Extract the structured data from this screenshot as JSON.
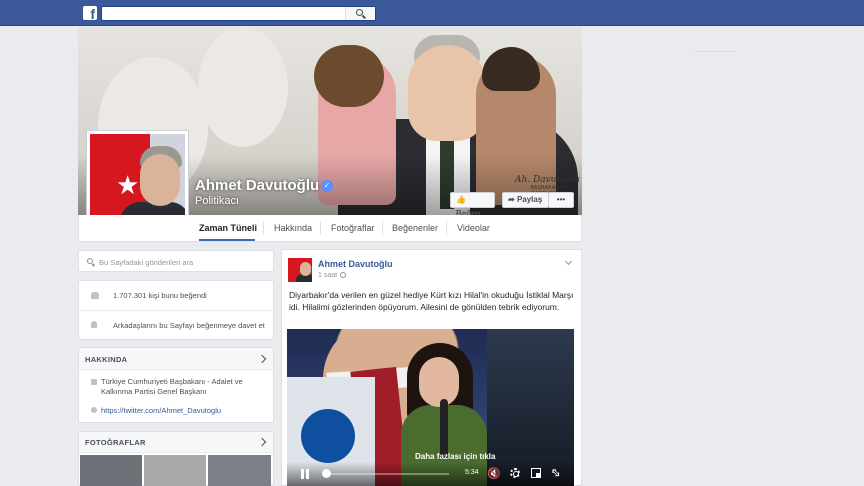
{
  "topbar": {
    "logo": "f",
    "search_placeholder": ""
  },
  "profile": {
    "name": "Ahmet Davutoğlu",
    "verified": "✓",
    "category": "Politikacı",
    "cover_signature": "Ah. Davutoğlu",
    "cover_caption": "BAŞBAKAN AK PARTİ GENEL BAŞKANI",
    "buttons": {
      "like": "Beğen",
      "share": "Paylaş",
      "more": "•••"
    }
  },
  "tabs": [
    {
      "label": "Zaman Tüneli",
      "active": true
    },
    {
      "label": "Hakkında"
    },
    {
      "label": "Fotoğraflar"
    },
    {
      "label": "Beğenenler"
    },
    {
      "label": "Videolar"
    }
  ],
  "left": {
    "search_placeholder": "Bu Sayfadaki gönderileri ara",
    "likes_text": "1.707.301 kişi bunu beğendi",
    "invite_text": "Arkadaşlarını bu Sayfayı beğenmeye davet et",
    "about": {
      "title": "HAKKINDA",
      "description": "Türkiye Cumhuriyeti Başbakanı - Adalet ve Kalkınma Partisi Genel Başkanı",
      "link": "https://twitter.com/Ahmet_Davutoglu"
    },
    "photos": {
      "title": "FOTOĞRAFLAR"
    }
  },
  "post": {
    "author": "Ahmet Davutoğlu",
    "time": "1 saat",
    "text": "Diyarbakır'da verilen en güzel hediye Kürt kızı Hilal'in okuduğu İstiklal Marşı idi. Hilalimi gözlerinden öpüyorum. Ailesini de gönülden tebrik ediyorum.",
    "video": {
      "overlay_text": "Daha fazlası için tıkla",
      "time_remaining": "5:34",
      "progress": 0.0
    }
  },
  "colors": {
    "brand": "#3b5998",
    "link": "#365899",
    "background": "#e9ebee"
  }
}
